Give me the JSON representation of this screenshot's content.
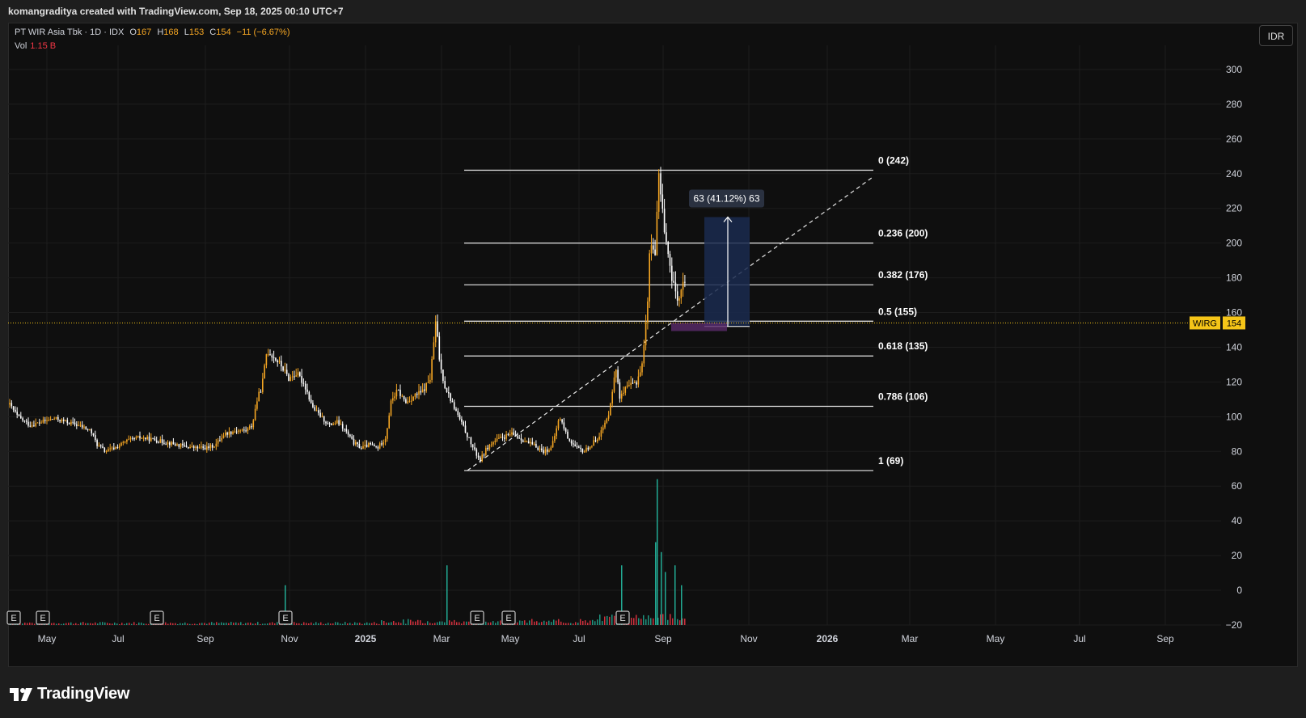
{
  "header": {
    "credit": "komangraditya created with TradingView.com, Sep 18, 2025 00:10 UTC+7"
  },
  "legend": {
    "symbol": "PT WIR Asia Tbk · 1D · IDX",
    "open_label": "O",
    "open": "167",
    "high_label": "H",
    "high": "168",
    "low_label": "L",
    "low": "153",
    "close_label": "C",
    "close": "154",
    "change": "−11 (−6.67%)",
    "vol_label": "Vol",
    "vol": "1.15 B"
  },
  "currency_button": "IDR",
  "footer": {
    "brand": "TradingView"
  },
  "colors": {
    "up": "#f5a623",
    "down": "#ffffff",
    "vol_up": "#22ab94",
    "vol_down": "#f23645",
    "accent": "#f5c518"
  },
  "chart_data": {
    "type": "candlestick",
    "ticker": "WIRG",
    "last_price": 154,
    "y_ticks": [
      -20,
      0,
      20,
      40,
      60,
      80,
      100,
      120,
      140,
      160,
      180,
      200,
      220,
      240,
      260,
      280,
      300
    ],
    "x_ticks": [
      "May",
      "Jul",
      "Sep",
      "Nov",
      "2025",
      "Mar",
      "May",
      "Jul",
      "Sep",
      "Nov",
      "2026",
      "Mar",
      "May",
      "Jul",
      "Sep"
    ],
    "ylim": [
      -20,
      320
    ],
    "fibonacci": [
      {
        "label": "0 (242)",
        "value": 242
      },
      {
        "label": "0.236 (200)",
        "value": 200
      },
      {
        "label": "0.382 (176)",
        "value": 176
      },
      {
        "label": "0.5 (155)",
        "value": 155
      },
      {
        "label": "0.618 (135)",
        "value": 135
      },
      {
        "label": "0.786 (106)",
        "value": 106
      },
      {
        "label": "1 (69)",
        "value": 69
      }
    ],
    "measure": {
      "label": "63 (41.12%) 63",
      "from": 152,
      "to": 215
    },
    "earnings_markers": [
      "E",
      "E",
      "E",
      "E",
      "E",
      "E",
      "E"
    ],
    "price_path": [
      [
        0,
        107
      ],
      [
        10,
        100
      ],
      [
        25,
        95
      ],
      [
        40,
        97
      ],
      [
        55,
        99
      ],
      [
        70,
        97
      ],
      [
        85,
        95
      ],
      [
        100,
        92
      ],
      [
        108,
        84
      ],
      [
        118,
        80
      ],
      [
        130,
        82
      ],
      [
        145,
        86
      ],
      [
        160,
        88
      ],
      [
        175,
        87
      ],
      [
        195,
        85
      ],
      [
        215,
        83
      ],
      [
        230,
        82
      ],
      [
        245,
        82
      ],
      [
        255,
        84
      ],
      [
        265,
        90
      ],
      [
        280,
        92
      ],
      [
        292,
        92
      ],
      [
        300,
        95
      ],
      [
        305,
        108
      ],
      [
        312,
        118
      ],
      [
        318,
        138
      ],
      [
        325,
        135
      ],
      [
        335,
        130
      ],
      [
        345,
        122
      ],
      [
        355,
        125
      ],
      [
        365,
        118
      ],
      [
        375,
        105
      ],
      [
        385,
        100
      ],
      [
        395,
        95
      ],
      [
        405,
        97
      ],
      [
        415,
        92
      ],
      [
        425,
        85
      ],
      [
        435,
        82
      ],
      [
        445,
        84
      ],
      [
        455,
        82
      ],
      [
        465,
        88
      ],
      [
        472,
        110
      ],
      [
        480,
        115
      ],
      [
        490,
        108
      ],
      [
        500,
        112
      ],
      [
        510,
        114
      ],
      [
        520,
        122
      ],
      [
        527,
        155
      ],
      [
        532,
        130
      ],
      [
        538,
        118
      ],
      [
        545,
        110
      ],
      [
        555,
        100
      ],
      [
        565,
        90
      ],
      [
        575,
        80
      ],
      [
        582,
        75
      ],
      [
        590,
        82
      ],
      [
        600,
        86
      ],
      [
        610,
        88
      ],
      [
        620,
        90
      ],
      [
        630,
        88
      ],
      [
        640,
        85
      ],
      [
        650,
        83
      ],
      [
        660,
        80
      ],
      [
        670,
        82
      ],
      [
        680,
        100
      ],
      [
        690,
        88
      ],
      [
        700,
        82
      ],
      [
        710,
        80
      ],
      [
        720,
        84
      ],
      [
        730,
        90
      ],
      [
        740,
        100
      ],
      [
        745,
        115
      ],
      [
        750,
        128
      ],
      [
        755,
        110
      ],
      [
        760,
        115
      ],
      [
        768,
        118
      ],
      [
        775,
        120
      ],
      [
        782,
        130
      ],
      [
        788,
        160
      ],
      [
        792,
        200
      ],
      [
        798,
        195
      ],
      [
        803,
        240
      ],
      [
        808,
        215
      ],
      [
        812,
        200
      ],
      [
        818,
        180
      ],
      [
        823,
        172
      ],
      [
        828,
        168
      ],
      [
        833,
        178
      ],
      [
        838,
        170
      ],
      [
        843,
        155
      ],
      [
        846,
        154
      ]
    ],
    "volume_spikes": [
      [
        330,
        12
      ],
      [
        530,
        18
      ],
      [
        746,
        18
      ],
      [
        788,
        25
      ],
      [
        790,
        44
      ],
      [
        795,
        22
      ],
      [
        800,
        16
      ],
      [
        812,
        18
      ],
      [
        820,
        12
      ]
    ]
  }
}
